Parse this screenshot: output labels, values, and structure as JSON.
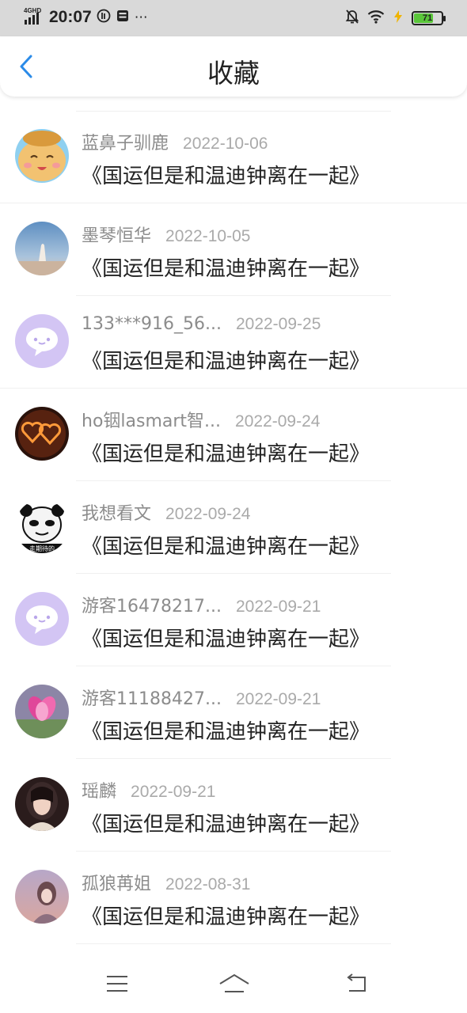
{
  "status_bar": {
    "network": "4GHD",
    "time": "20:07",
    "battery": "71",
    "battery_level": 0.71,
    "battery_color": "#5ac63a",
    "icons": [
      "signal-icon",
      "speed-icon",
      "storage-icon",
      "more-dots-icon",
      "mute-icon",
      "wifi-icon",
      "charging-icon",
      "battery-icon"
    ]
  },
  "header": {
    "title": "收藏",
    "back_icon": "chevron-left-icon",
    "accent": "#2b8be8"
  },
  "favorites": [
    {
      "user": "蓝鼻子驯鹿",
      "date": "2022-10-06",
      "book": "《国运但是和温迪钟离在一起》",
      "avatar": "cartoon-avatar"
    },
    {
      "user": "墨琴恒华",
      "date": "2022-10-05",
      "book": "《国运但是和温迪钟离在一起》",
      "avatar": "sky-avatar"
    },
    {
      "user": "133***916_56...",
      "date": "2022-09-25",
      "book": "《国运但是和温迪钟离在一起》",
      "avatar": "default-chat-avatar"
    },
    {
      "user": "ho铟lasmart智...",
      "date": "2022-09-24",
      "book": "《国运但是和温迪钟离在一起》",
      "avatar": "hearts-avatar"
    },
    {
      "user": "我想看文",
      "date": "2022-09-24",
      "book": "《国运但是和温迪钟离在一起》",
      "avatar": "panda-meme-avatar",
      "badge": "走期待的"
    },
    {
      "user": "游客16478217...",
      "date": "2022-09-21",
      "book": "《国运但是和温迪钟离在一起》",
      "avatar": "default-chat-avatar"
    },
    {
      "user": "游客11188427...",
      "date": "2022-09-21",
      "book": "《国运但是和温迪钟离在一起》",
      "avatar": "flower-avatar"
    },
    {
      "user": "瑶麟",
      "date": "2022-09-21",
      "book": "《国运但是和温迪钟离在一起》",
      "avatar": "portrait-avatar"
    },
    {
      "user": "孤狼苒姐",
      "date": "2022-08-31",
      "book": "《国运但是和温迪钟离在一起》",
      "avatar": "girl-avatar"
    }
  ],
  "nav_bar": {
    "icons": [
      "menu-icon",
      "home-icon",
      "back-icon"
    ]
  }
}
